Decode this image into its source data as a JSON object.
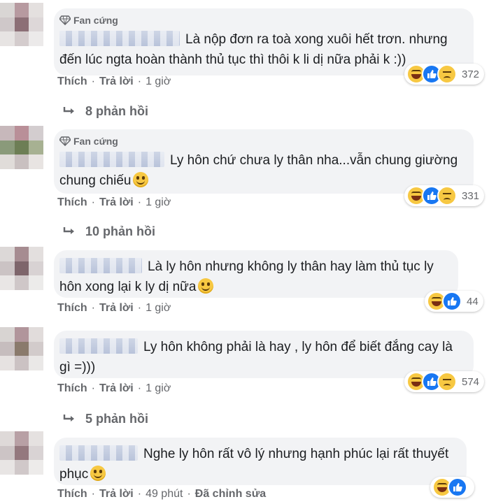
{
  "colors": {
    "bubble_bg": "#f2f3f5",
    "meta_text": "#65676b",
    "body_text": "#1c1e21",
    "like_blue": "#1877f2",
    "emoji_yellow": "#f7c842"
  },
  "comments": [
    {
      "badge": "Fan cứng",
      "text": "Là nộp đơn ra toà xong xuôi hết trơn. nhưng đến lúc ngta hoàn thành thủ tục thì thôi k li dị nữa phải k :))",
      "reactions": [
        "haha",
        "like",
        "sad"
      ],
      "reaction_count": "372",
      "like": "Thích",
      "reply": "Trả lời",
      "time": "1 giờ",
      "replies": "8 phản hồi"
    },
    {
      "badge": "Fan cứng",
      "text": "Ly hôn chứ chưa ly thân nha...vẫn chung giường chung chiếu",
      "emoji": "smiling-wink-emoji",
      "reactions": [
        "haha",
        "like",
        "sad"
      ],
      "reaction_count": "331",
      "like": "Thích",
      "reply": "Trả lời",
      "time": "1 giờ",
      "replies": "10 phản hồi"
    },
    {
      "text": "Là ly hôn nhưng không ly thân hay làm thủ tục ly hôn xong lại k ly dị nữa",
      "emoji": "thinking-emoji",
      "reactions": [
        "haha",
        "like"
      ],
      "reaction_count": "44",
      "like": "Thích",
      "reply": "Trả lời",
      "time": "1 giờ"
    },
    {
      "text": "Ly hôn không phải là hay , ly hôn để biết đắng cay là gì =)))",
      "reactions": [
        "haha",
        "like",
        "sad"
      ],
      "reaction_count": "574",
      "like": "Thích",
      "reply": "Trả lời",
      "time": "1 giờ",
      "replies": "5 phản hồi"
    },
    {
      "text": "Nghe ly hôn rất vô lý nhưng hạnh phúc lại rất thuyết phục",
      "emoji": "tears-of-joy-emoji",
      "reactions": [
        "haha",
        "like"
      ],
      "reaction_count": "",
      "like": "Thích",
      "reply": "Trả lời",
      "time": "49 phút",
      "edited": "Đã chỉnh sửa"
    }
  ]
}
